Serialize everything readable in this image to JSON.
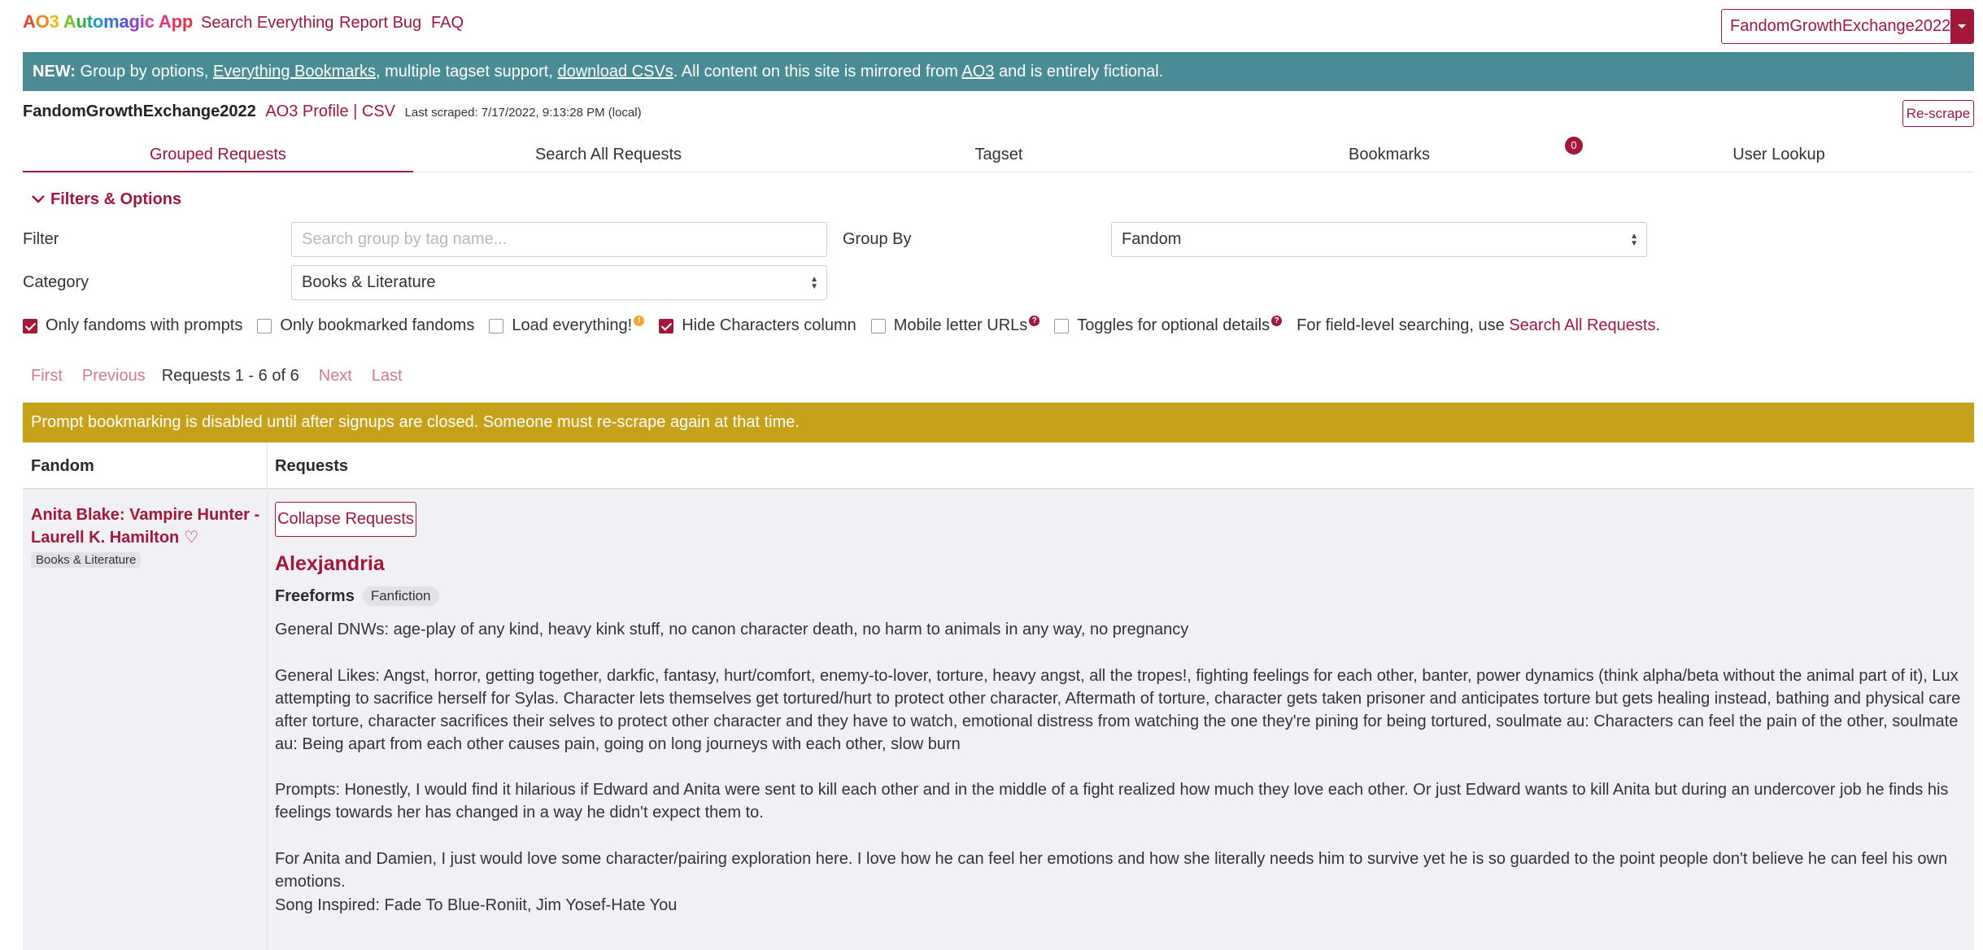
{
  "nav": {
    "brand": "AO3 Automagic App",
    "links": [
      "Search Everything",
      "Report Bug",
      "FAQ"
    ],
    "user": "FandomGrowthExchange2022"
  },
  "banner": {
    "new": "NEW:",
    "t1": " Group by options, ",
    "l1": "Everything Bookmarks",
    "t2": ", multiple tagset support, ",
    "l2": "download CSVs",
    "t3": ". All content on this site is mirrored from ",
    "l3": "AO3",
    "t4": " and is entirely fictional."
  },
  "meta": {
    "name": "FandomGrowthExchange2022",
    "profile": "AO3 Profile",
    "sep": " | ",
    "csv": "CSV",
    "scraped": "Last scraped: 7/17/2022, 9:13:28 PM (local)",
    "rescrape": "Re-scrape"
  },
  "tabs": [
    "Grouped Requests",
    "Search All Requests",
    "Tagset",
    "Bookmarks",
    "User Lookup"
  ],
  "bookmark_count": "0",
  "filters": {
    "heading": "Filters & Options",
    "filter_label": "Filter",
    "filter_placeholder": "Search group by tag name...",
    "groupby_label": "Group By",
    "groupby_value": "Fandom",
    "category_label": "Category",
    "category_value": "Books & Literature",
    "checkboxes": [
      {
        "label": "Only fandoms with prompts",
        "checked": true
      },
      {
        "label": "Only bookmarked fandoms",
        "checked": false
      },
      {
        "label": "Load everything!",
        "checked": false
      },
      {
        "label": "Hide Characters column",
        "checked": true
      },
      {
        "label": "Mobile letter URLs",
        "checked": false
      },
      {
        "label": "Toggles for optional details",
        "checked": false
      }
    ],
    "field_note": "For field-level searching, use ",
    "field_link": "Search All Requests",
    "field_end": "."
  },
  "pager": {
    "first": "First",
    "previous": "Previous",
    "range": "Requests 1 - 6 of 6",
    "next": "Next",
    "last": "Last"
  },
  "warning": "Prompt bookmarking is disabled until after signups are closed. Someone must re-scrape again at that time.",
  "table": {
    "headers": [
      "Fandom",
      "Requests"
    ],
    "rows": [
      {
        "fandom": "Anita Blake: Vampire Hunter - Laurell K. Hamilton",
        "category": "Books & Literature",
        "collapse": "Collapse Requests",
        "requester": "Alexjandria",
        "freeforms_label": "Freeforms",
        "freeform": "Fanfiction",
        "paragraphs": [
          "General DNWs: age-play of any kind, heavy kink stuff, no canon character death, no harm to animals in any way, no pregnancy",
          "General Likes: Angst, horror, getting together, darkfic, fantasy, hurt/comfort, enemy-to-lover, torture, heavy angst, all the tropes!, fighting feelings for each other, banter, power dynamics (think alpha/beta without the animal part of it), Lux attempting to sacrifice herself for Sylas. Character lets themselves get tortured/hurt to protect other character, Aftermath of torture, character gets taken prisoner and anticipates torture but gets healing instead, bathing and physical care after torture, character sacrifices their selves to protect other character and they have to watch, emotional distress from watching the one they're pining for being tortured, soulmate au: Characters can feel the pain of the other, soulmate au: Being apart from each other causes pain, going on long journeys with each other, slow burn",
          "Prompts: Honestly, I would find it hilarious if Edward and Anita were sent to kill each other and in the middle of a fight realized how much they love each other. Or just Edward wants to kill Anita but during an undercover job he finds his feelings towards her has changed in a way he didn't expect them to.",
          "For Anita and Damien, I just would love some character/pairing exploration here. I love how he can feel her emotions and how she literally needs him to survive yet he is so guarded to the point people don't believe he can feel his own emotions.",
          "Song Inspired: Fade To Blue-Roniit, Jim Yosef-Hate You"
        ]
      }
    ]
  },
  "colors": {
    "accent": "#a2173a",
    "banner": "#4a8b96",
    "warning": "#c6a21a",
    "row_bg": "#f1f1f5"
  }
}
